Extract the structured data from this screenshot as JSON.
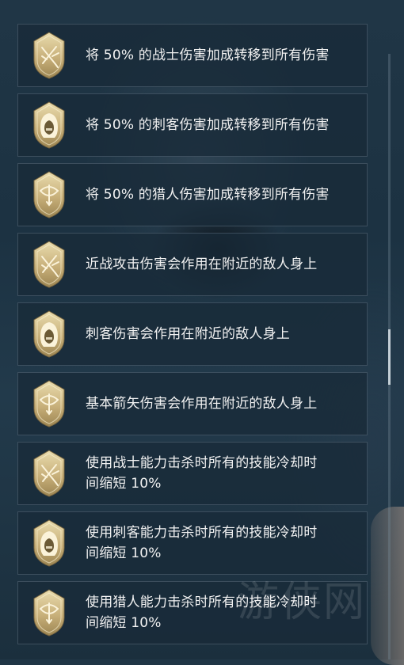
{
  "skills": [
    {
      "icon": "sword-icon",
      "text": "将 50% 的战士伤害加成转移到所有伤害"
    },
    {
      "icon": "hood-icon",
      "text": "将 50% 的刺客伤害加成转移到所有伤害"
    },
    {
      "icon": "bow-icon",
      "text": "将 50% 的猎人伤害加成转移到所有伤害"
    },
    {
      "icon": "sword-icon",
      "text": "近战攻击伤害会作用在附近的敌人身上"
    },
    {
      "icon": "hood-icon",
      "text": "刺客伤害会作用在附近的敌人身上"
    },
    {
      "icon": "bow-icon",
      "text": "基本箭矢伤害会作用在附近的敌人身上"
    },
    {
      "icon": "sword-icon",
      "text_line1": "使用战士能力击杀时所有的技能冷却时",
      "text_line2": "间缩短 10%"
    },
    {
      "icon": "hood-icon",
      "text_line1": "使用刺客能力击杀时所有的技能冷却时",
      "text_line2": "间缩短 10%"
    },
    {
      "icon": "bow-icon",
      "text_line1": "使用猎人能力击杀时所有的技能冷却时",
      "text_line2": "间缩短 10%"
    }
  ],
  "watermark": "游侠网",
  "colors": {
    "badge_gold": "#c9b27a",
    "badge_inner": "#e7d8a8",
    "text": "#f2f2f2"
  }
}
